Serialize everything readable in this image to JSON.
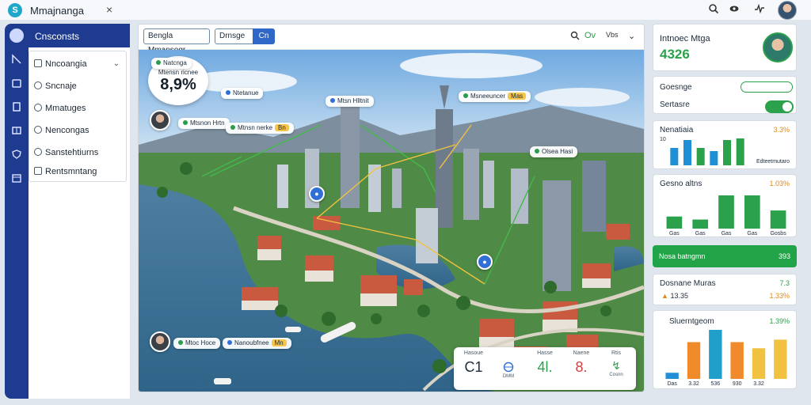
{
  "app": {
    "title": "Mmajnanga",
    "close": "×",
    "logo": "S"
  },
  "topbar": {
    "icons": [
      "search-icon",
      "eye-icon",
      "pulse-icon"
    ]
  },
  "sidebar": {
    "header": "Cnsconsts",
    "items": [
      {
        "label": "Nncoangia",
        "icon": "list-icon",
        "has_chevron": true
      },
      {
        "label": "Sncnaje",
        "icon": "pin-icon"
      },
      {
        "label": "Mmatuges",
        "icon": "circle-icon"
      },
      {
        "label": "Nencongas",
        "icon": "tag-icon"
      },
      {
        "label": "Sanstehtiurns",
        "icon": "eye-icon"
      },
      {
        "label": "Rentsmntang",
        "icon": "doc-icon"
      }
    ]
  },
  "toolbar": {
    "field1": "Bengla Mmansogr",
    "field2": "Drnsge",
    "button": "Cn",
    "right_label": "Ov",
    "right_value": "Vbs"
  },
  "map": {
    "bubble_label": "Mtensn ricnee",
    "bubble_value": "8,9%",
    "callouts": [
      {
        "id": "c1",
        "text": "Natcnga",
        "tag": ""
      },
      {
        "id": "c2",
        "text": "Ntetanue",
        "tag": ""
      },
      {
        "id": "c3",
        "text": "Mtsn Hlltnit",
        "tag": ""
      },
      {
        "id": "c4",
        "text": "Msneeuncer",
        "tag": "Mas"
      },
      {
        "id": "c5",
        "text": "Mtsnon Hrtn",
        "tag": ""
      },
      {
        "id": "c6",
        "text": "Mtnsn nerke",
        "tag": "Bn"
      },
      {
        "id": "c7",
        "text": "Olsea Hasi",
        "tag": ""
      },
      {
        "id": "c8",
        "text": "Mtoc Hoce",
        "tag": ""
      },
      {
        "id": "c9",
        "text": "Nanoubfnee",
        "tag": "Mn"
      }
    ],
    "stats": [
      {
        "label": "Hasoue",
        "value": "C1",
        "sub": ""
      },
      {
        "label": "",
        "value": "",
        "sub": "DMM"
      },
      {
        "label": "Hasse",
        "value": "4l.",
        "sub": ""
      },
      {
        "label": "Naene",
        "value": "8.",
        "sub": ""
      },
      {
        "label": "Rtis",
        "value": "",
        "sub": "Cosnn"
      }
    ]
  },
  "right": {
    "profile": {
      "name": "Intnoec Mtga",
      "value": "4326"
    },
    "search_card": {
      "label": "Goesnge"
    },
    "toggle_card": {
      "label": "Sertasre"
    },
    "card1": {
      "title": "Nenatiaia",
      "value": "3.3%",
      "footer": "Edteetmutaro",
      "bars": [
        22,
        32,
        22,
        18,
        32,
        34
      ],
      "tick": "10"
    },
    "card2": {
      "title": "Gesno altns",
      "value": "1.03%",
      "bars": [
        8,
        6,
        22,
        22,
        12
      ],
      "labels": [
        "Gas",
        "Gas",
        "Gas",
        "Gas",
        "Gosbs"
      ]
    },
    "green_banner": {
      "label": "Nosa batngmn",
      "value": "393"
    },
    "card3": {
      "title": "Dosnane Muras",
      "value": "7.3",
      "row_label": "13.35",
      "row_value": "1.33%"
    },
    "card4": {
      "title": "Sluerntgeom",
      "value": "1.39%",
      "bars": [
        5,
        30,
        40,
        30,
        25,
        32
      ],
      "labels": [
        "Das",
        "3.32",
        "536",
        "930",
        "3.32"
      ]
    }
  }
}
